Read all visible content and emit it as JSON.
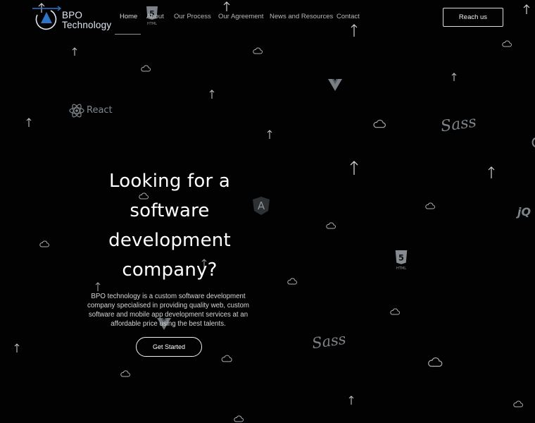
{
  "brand": {
    "name_line1": "BPO",
    "name_line2": "Technology",
    "logo_icon": "triangle-in-circle-logo-icon",
    "accent": "#2f74c8"
  },
  "nav": {
    "items": [
      {
        "label": "Home",
        "active": true
      },
      {
        "label": "About",
        "active": false
      },
      {
        "label": "Our Process",
        "active": false
      },
      {
        "label": "Our Agreement",
        "active": false
      },
      {
        "label": "News and Resources",
        "active": false
      },
      {
        "label": "Contact",
        "active": false
      }
    ],
    "reach_label": "Reach us"
  },
  "hero": {
    "title_lines": [
      "Looking for a",
      "software",
      "development",
      "company?"
    ],
    "description": "BPO technology is a custom software development company specialised in providing quality web, custom software and mobile app development services at an affordable price using the best talents.",
    "cta_label": "Get Started"
  },
  "background": {
    "react_label": "React",
    "html_label": "HTML",
    "sass_label": "Sass",
    "jquery_label": "jQ",
    "html_badge_number": "5",
    "angular_letter": "A",
    "colors": {
      "background": "#020202",
      "icon_gray": "#7f868b",
      "icon_light": "#b8bcc0"
    },
    "icons": [
      "cloud-icon",
      "arrow-up-icon",
      "react-icon",
      "html5-icon",
      "sass-icon",
      "vue-icon",
      "angular-icon",
      "jquery-icon"
    ]
  }
}
